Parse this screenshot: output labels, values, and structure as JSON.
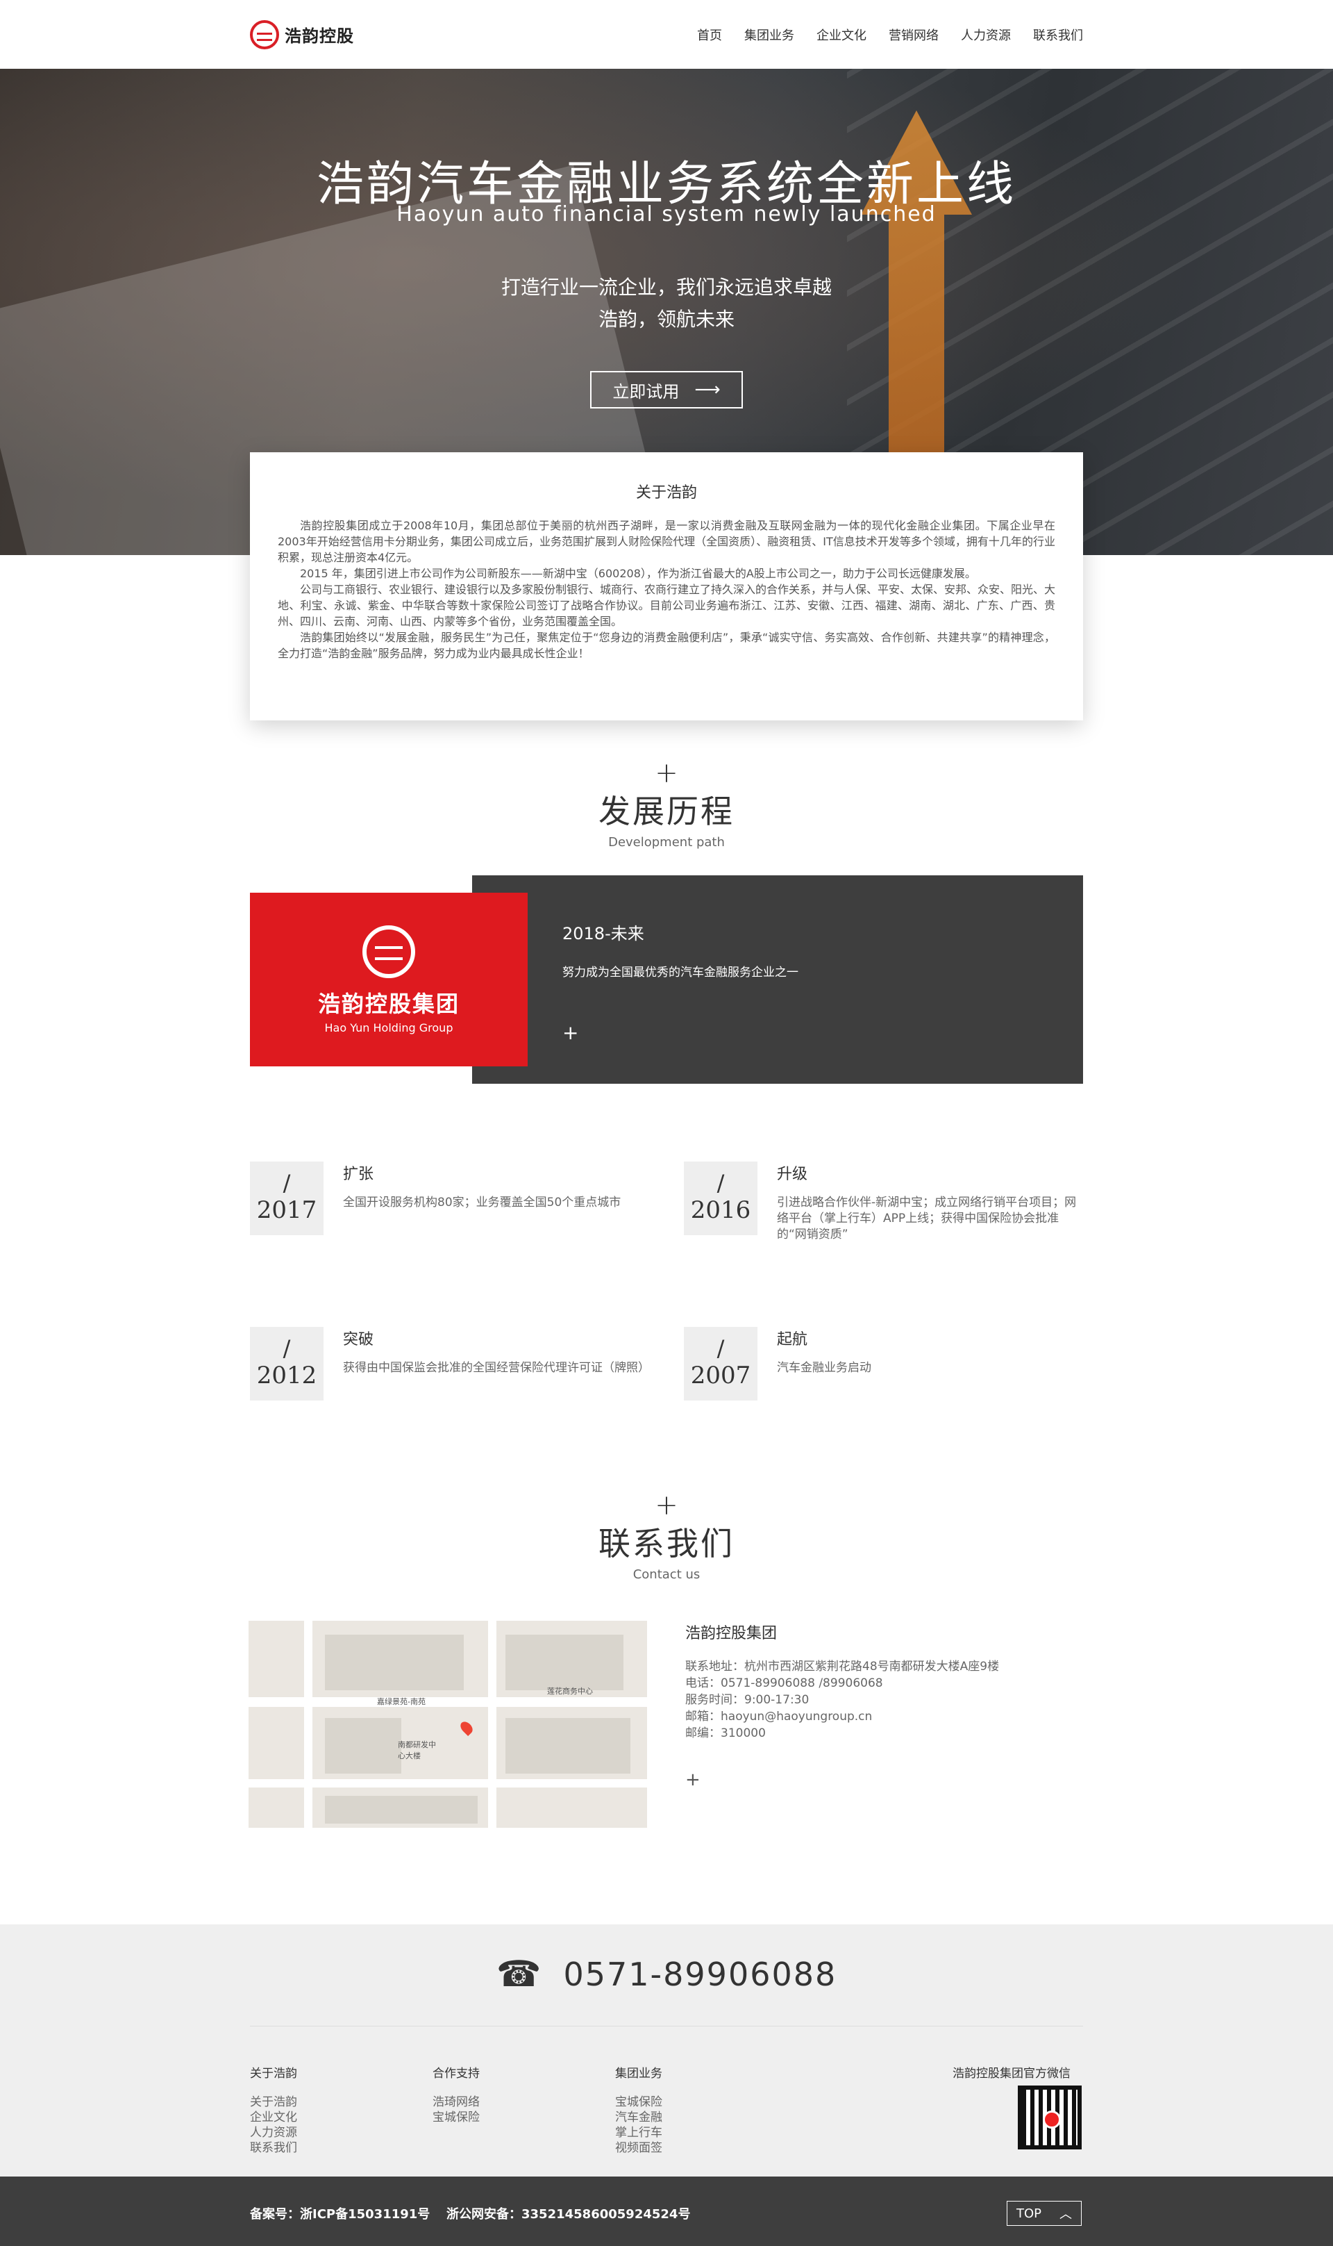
{
  "brand": {
    "name": "浩韵控股"
  },
  "nav": [
    "首页",
    "集团业务",
    "企业文化",
    "营销网络",
    "人力资源",
    "联系我们"
  ],
  "hero": {
    "title": "浩韵汽车金融业务系统全新上线",
    "subtitle": "Haoyun auto financial system newly launched",
    "slogan1": "打造行业一流企业，我们永远追求卓越",
    "slogan2": "浩韵，领航未来",
    "button": "立即试用"
  },
  "about": {
    "title": "关于浩韵",
    "paragraphs": [
      "浩韵控股集团成立于2008年10月，集团总部位于美丽的杭州西子湖畔，是一家以消费金融及互联网金融为一体的现代化金融企业集团。下属企业早在2003年开始经营信用卡分期业务，集团公司成立后，业务范围扩展到人财险保险代理（全国资质）、融资租赁、IT信息技术开发等多个领域，拥有十几年的行业积累，现总注册资本4亿元。",
      "2015 年，集团引进上市公司作为公司新股东——新湖中宝（600208），作为浙江省最大的A股上市公司之一，助力于公司长远健康发展。",
      "公司与工商银行、农业银行、建设银行以及多家股份制银行、城商行、农商行建立了持久深入的合作关系，并与人保、平安、太保、安邦、众安、阳光、大地、利宝、永诚、紫金、中华联合等数十家保险公司签订了战略合作协议。目前公司业务遍布浙江、江苏、安徽、江西、福建、湖南、湖北、广东、广西、贵州、四川、云南、河南、山西、内蒙等多个省份，业务范围覆盖全国。",
      "浩韵集团始终以“发展金融，服务民生”为己任，聚焦定位于“您身边的消费金融便利店”，秉承“诚实守信、务实高效、合作创新、共建共享”的精神理念，全力打造“浩韵金融”服务品牌，努力成为业内最具成长性企业！"
    ]
  },
  "history": {
    "plus": "+",
    "title": "发展历程",
    "subtitle": "Development path",
    "feature": {
      "brand_cn": "浩韵控股集团",
      "brand_en": "Hao Yun Holding Group",
      "year": "2018-未来",
      "desc": "努力成为全国最优秀的汽车金融服务企业之一",
      "more": "+"
    },
    "timeline": [
      {
        "slash": "/",
        "year": "2017",
        "title": "扩张",
        "desc": "全国开设服务机构80家；业务覆盖全国50个重点城市"
      },
      {
        "slash": "/",
        "year": "2016",
        "title": "升级",
        "desc": "引进战略合作伙伴-新湖中宝；成立网络行销平台项目；网络平台（掌上行车）APP上线；获得中国保险协会批准的“网销资质”"
      },
      {
        "slash": "/",
        "year": "2012",
        "title": "突破",
        "desc": "获得由中国保监会批准的全国经营保险代理许可证（牌照）"
      },
      {
        "slash": "/",
        "year": "2007",
        "title": "起航",
        "desc": "汽车金融业务启动"
      }
    ]
  },
  "contact": {
    "plus": "+",
    "title": "联系我们",
    "subtitle": "Contact us",
    "map_labels": [
      "嘉绿景苑-南苑",
      "南都研发中心大楼",
      "莲花商务中心"
    ],
    "company": "浩韵控股集团",
    "lines": [
      "联系地址：杭州市西湖区紫荆花路48号南都研发大楼A座9楼",
      "电话：0571-89906088 /89906068",
      "服务时间：9:00-17:30",
      "邮箱：haoyun@haoyungroup.cn",
      "邮编：310000"
    ],
    "more": "+"
  },
  "footer": {
    "phone": "0571-89906088",
    "columns": [
      {
        "title": "关于浩韵",
        "links": [
          "关于浩韵",
          "企业文化",
          "人力资源",
          "联系我们"
        ]
      },
      {
        "title": "合作支持",
        "links": [
          "浩琦网络",
          "宝城保险"
        ]
      },
      {
        "title": "集团业务",
        "links": [
          "宝城保险",
          "汽车金融",
          "掌上行车",
          "视频面签"
        ]
      }
    ],
    "wechat_title": "浩韵控股集团官方微信",
    "icp": "备案号：浙ICP备15031191号",
    "police": "浙公网安备：33521458600592452​4号",
    "top": "TOP"
  }
}
